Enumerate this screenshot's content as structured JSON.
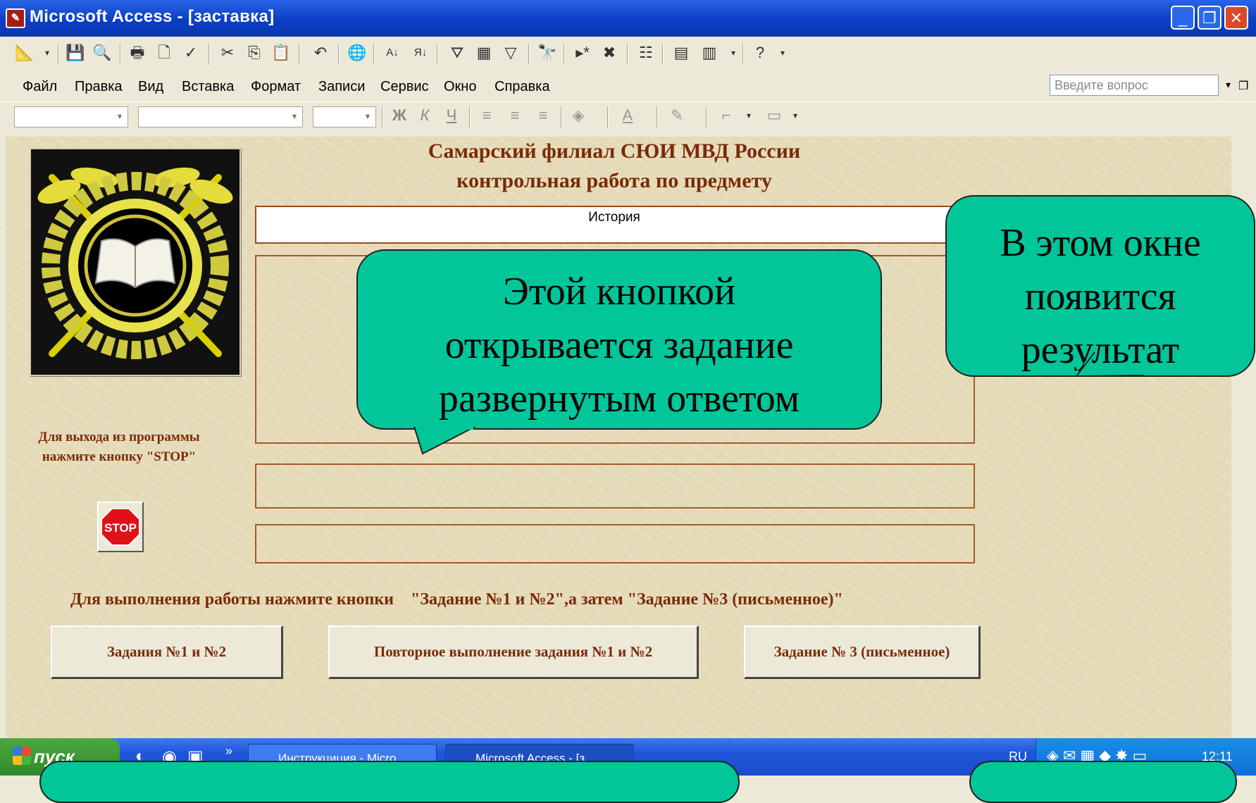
{
  "window": {
    "title": "Microsoft Access - [заставка]"
  },
  "menu": [
    "Файл",
    "Правка",
    "Вид",
    "Вставка",
    "Формат",
    "Записи",
    "Сервис",
    "Окно",
    "Справка"
  ],
  "help_placeholder": "Введите вопрос",
  "toolbar2": {
    "bold": "Ж",
    "italic": "К",
    "underline": "Ч"
  },
  "form": {
    "heading_line1": "Самарский филиал СЮИ МВД России",
    "heading_line2": "контрольная работа по предмету",
    "subject": "История",
    "exit_note_line1": "Для выхода из программы",
    "exit_note_line2": "нажмите кнопку \"STOP\"",
    "stop_label": "STOP",
    "instruction": "Для выполнения работы нажмите кнопки    \"Задание №1 и №2\",а затем \"Задание №3 (письменное)\"",
    "buttons": [
      "Задания  №1 и №2",
      "Повторное выполнение задания №1 и №2",
      "Задание № 3 (письменное)"
    ]
  },
  "callouts": {
    "task_button": "Этой кнопкой открывается задание развернутым ответом",
    "result_window": "В этом окне появится результат"
  },
  "taskbar": {
    "start": "пуск",
    "tasks": [
      "Инструкциция - Micro...",
      "Microsoft Access - [з..."
    ],
    "lang": "RU",
    "clock": "12:11"
  }
}
